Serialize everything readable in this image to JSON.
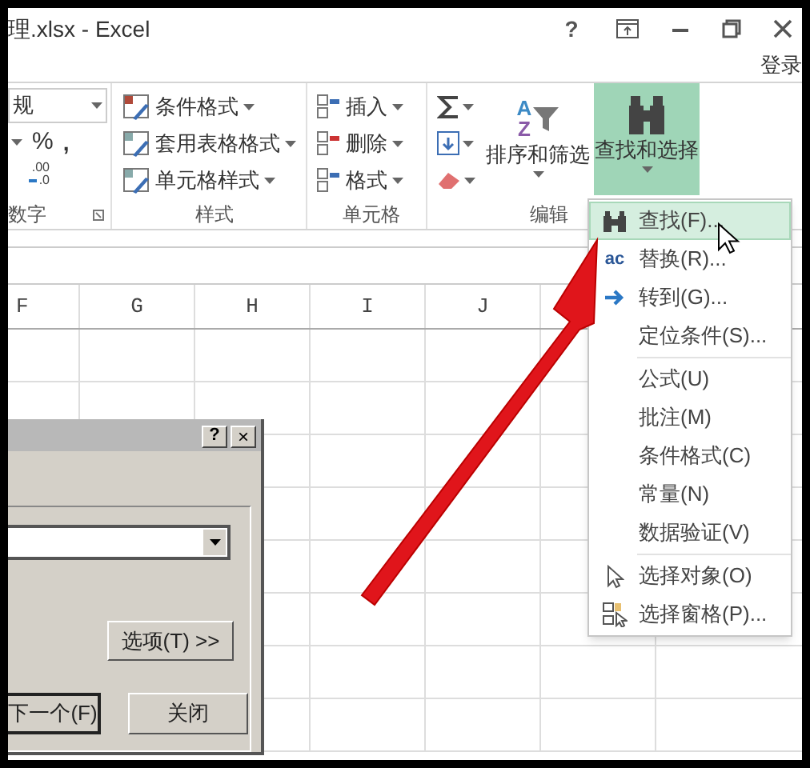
{
  "window": {
    "title": "理.xlsx - Excel",
    "help": "?",
    "sign_in": "登录"
  },
  "ribbon": {
    "number": {
      "format_value": "规",
      "percent": "%",
      "comma": ",",
      "decimal_icon_text": [
        ".00",
        ".0"
      ],
      "label": "数字"
    },
    "styles": {
      "items": [
        "条件格式",
        "套用表格格式",
        "单元格样式"
      ],
      "label": "样式"
    },
    "cells": {
      "items": [
        "插入",
        "删除",
        "格式"
      ],
      "label": "单元格"
    },
    "editing": {
      "sort_icon_text": [
        "A",
        "Z"
      ],
      "sort": "排序和筛选",
      "find": {
        "label": "查找和选择",
        "selected": true
      },
      "label": "编辑"
    }
  },
  "menu": [
    {
      "kind": "item",
      "label": "查找(F)...",
      "selected": true
    },
    {
      "kind": "item",
      "icon_text": "ac",
      "label": "替换(R)...",
      "selected": false
    },
    {
      "kind": "item",
      "label": "转到(G)...",
      "selected": false
    },
    {
      "kind": "item",
      "label": "定位条件(S)...",
      "selected": false
    },
    {
      "kind": "separator"
    },
    {
      "kind": "item",
      "label": "公式(U)",
      "selected": false
    },
    {
      "kind": "item",
      "label": "批注(M)",
      "selected": false
    },
    {
      "kind": "item",
      "label": "条件格式(C)",
      "selected": false
    },
    {
      "kind": "item",
      "label": "常量(N)",
      "selected": false
    },
    {
      "kind": "item",
      "label": "数据验证(V)",
      "selected": false
    },
    {
      "kind": "separator"
    },
    {
      "kind": "item",
      "label": "选择对象(O)",
      "selected": false
    },
    {
      "kind": "item",
      "label": "选择窗格(P)...",
      "selected": false
    }
  ],
  "sheet": {
    "columns": [
      "F",
      "G",
      "H",
      "I",
      "J"
    ]
  },
  "dialog": {
    "help": "?",
    "close": "×",
    "options_button": "选项(T) >>",
    "find_next_button": "下一个(F)",
    "close_button": "关闭"
  }
}
